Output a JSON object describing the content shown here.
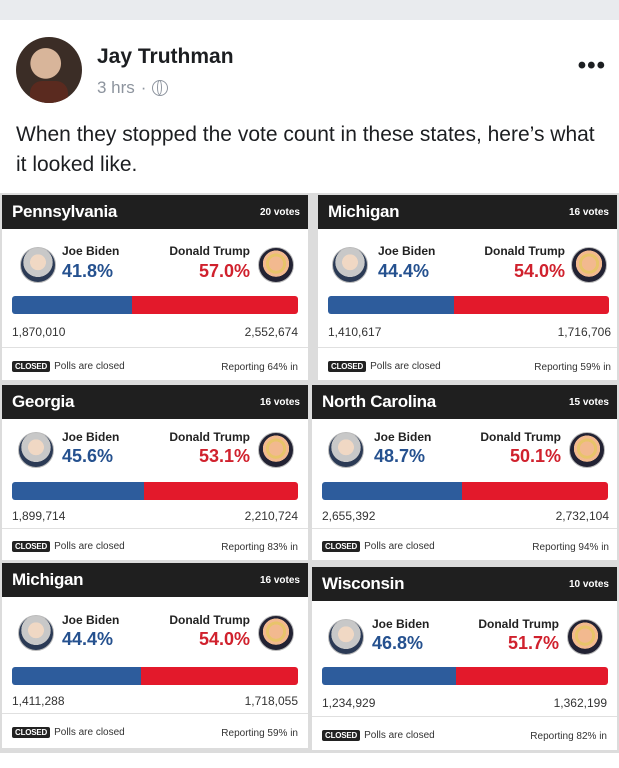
{
  "post": {
    "author": "Jay Truthman",
    "time": "3 hrs",
    "dot": "·",
    "more": "•••",
    "text": "When they stopped the vote count in these states, here’s what it looked like."
  },
  "cards": [
    {
      "state": "Pennsylvania",
      "votes": "20 votes",
      "biden_name": "Joe Biden",
      "biden_pct": "41.8%",
      "biden_votes": "1,870,010",
      "trump_name": "Donald Trump",
      "trump_pct": "57.0%",
      "trump_votes": "2,552,674",
      "closed_tag": "CLOSED",
      "closed_text": "Polls are closed",
      "reporting": "Reporting 64% in",
      "biden_share": 0.42
    },
    {
      "state": "Michigan",
      "votes": "16 votes",
      "biden_name": "Joe Biden",
      "biden_pct": "44.4%",
      "biden_votes": "1,410,617",
      "trump_name": "Donald Trump",
      "trump_pct": "54.0%",
      "trump_votes": "1,716,706",
      "closed_tag": "CLOSED",
      "closed_text": "Polls are closed",
      "reporting": "Reporting 59% in",
      "biden_share": 0.45
    },
    {
      "state": "Georgia",
      "votes": "16 votes",
      "biden_name": "Joe Biden",
      "biden_pct": "45.6%",
      "biden_votes": "1,899,714",
      "trump_name": "Donald Trump",
      "trump_pct": "53.1%",
      "trump_votes": "2,210,724",
      "closed_tag": "CLOSED",
      "closed_text": "Polls are closed",
      "reporting": "Reporting 83% in",
      "biden_share": 0.46
    },
    {
      "state": "North Carolina",
      "votes": "15 votes",
      "biden_name": "Joe Biden",
      "biden_pct": "48.7%",
      "biden_votes": "2,655,392",
      "trump_name": "Donald Trump",
      "trump_pct": "50.1%",
      "trump_votes": "2,732,104",
      "closed_tag": "CLOSED",
      "closed_text": "Polls are closed",
      "reporting": "Reporting 94% in",
      "biden_share": 0.49
    },
    {
      "state": "Michigan",
      "votes": "16 votes",
      "biden_name": "Joe Biden",
      "biden_pct": "44.4%",
      "biden_votes": "1,411,288",
      "trump_name": "Donald Trump",
      "trump_pct": "54.0%",
      "trump_votes": "1,718,055",
      "closed_tag": "CLOSED",
      "closed_text": "Polls are closed",
      "reporting": "Reporting 59% in",
      "biden_share": 0.45
    },
    {
      "state": "Wisconsin",
      "votes": "10 votes",
      "biden_name": "Joe Biden",
      "biden_pct": "46.8%",
      "biden_votes": "1,234,929",
      "trump_name": "Donald Trump",
      "trump_pct": "51.7%",
      "trump_votes": "1,362,199",
      "closed_tag": "CLOSED",
      "closed_text": "Polls are closed",
      "reporting": "Reporting 82% in",
      "biden_share": 0.47
    }
  ]
}
